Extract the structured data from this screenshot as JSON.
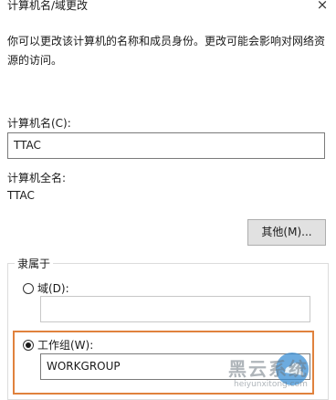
{
  "window": {
    "title": "计算机名/域更改",
    "close_icon": "×"
  },
  "description": "你可以更改该计算机的名称和成员身份。更改可能会影响对网络资源的访问。",
  "computer_name": {
    "label": "计算机名(C):",
    "value": "TTAC"
  },
  "full_name": {
    "label": "计算机全名:",
    "value": "TTAC"
  },
  "more_button": "其他(M)...",
  "member_of": {
    "title": "隶属于",
    "domain": {
      "label": "域(D):",
      "value": "",
      "selected": false
    },
    "workgroup": {
      "label": "工作组(W):",
      "value": "WORKGROUP",
      "selected": true
    }
  },
  "watermark": {
    "brand": "黑云系统",
    "url": "heiyunxitong.com"
  },
  "colors": {
    "highlight": "#e0823d",
    "accent": "#3b8fd4"
  }
}
